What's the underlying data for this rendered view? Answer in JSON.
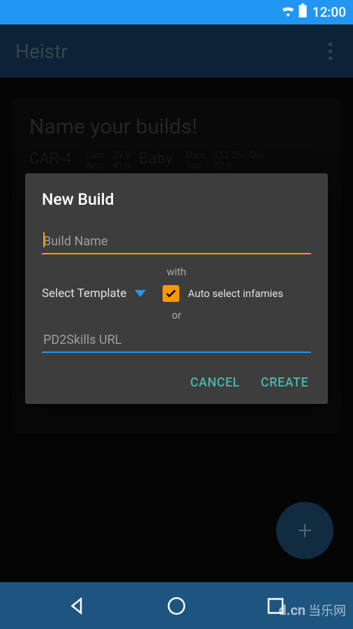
{
  "status": {
    "time": "12:00"
  },
  "appbar": {
    "title": "Heistr"
  },
  "background": {
    "heading": "Name your builds!",
    "weapon1": "CAR-4",
    "weapon2": "Baby",
    "dam_label": "Dam",
    "acc_label": "Acc",
    "det_label": "Det",
    "val1": "39.9",
    "val2": "41.9",
    "val3": "152.25",
    "val4": "72.9"
  },
  "dialog": {
    "title": "New Build",
    "build_name_placeholder": "Build Name",
    "with_label": "with",
    "template_label": "Select Template",
    "auto_infamies_label": "Auto select infamies",
    "auto_infamies_checked": true,
    "or_label": "or",
    "url_placeholder": "PD2Skills URL",
    "cancel": "CANCEL",
    "create": "CREATE"
  },
  "watermark": {
    "text": "当乐网",
    "prefix": "d.cn"
  }
}
